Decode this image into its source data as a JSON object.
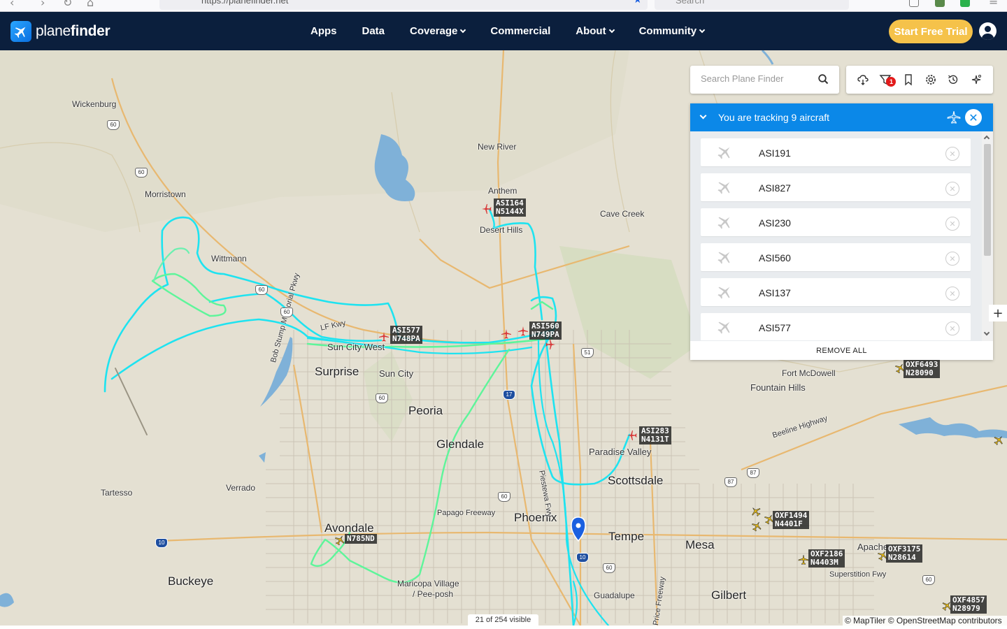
{
  "browser": {
    "url": "https://planefinder.net",
    "search_placeholder": "Search"
  },
  "header": {
    "brand_plain": "plane",
    "brand_bold": "finder",
    "nav": [
      {
        "label": "Apps",
        "dropdown": false
      },
      {
        "label": "Data",
        "dropdown": false
      },
      {
        "label": "Coverage",
        "dropdown": true
      },
      {
        "label": "Commercial",
        "dropdown": false
      },
      {
        "label": "About",
        "dropdown": true
      },
      {
        "label": "Community",
        "dropdown": true
      }
    ],
    "cta_label": "Start Free Trial",
    "colors": {
      "bar": "#0b1f3d",
      "cta": "#f5c24a"
    }
  },
  "map_search": {
    "placeholder": "Search Plane Finder"
  },
  "toolbar": {
    "icons": [
      "weather-icon",
      "filter-icon",
      "bookmark-icon",
      "settings-icon",
      "history-icon",
      "radar-icon"
    ],
    "filter_badge": "1"
  },
  "tracking": {
    "title": "You are tracking 9 aircraft",
    "items": [
      "ASI191",
      "ASI827",
      "ASI230",
      "ASI560",
      "ASI137",
      "ASI577"
    ],
    "remove_all": "REMOVE ALL",
    "color": "#0b88e8"
  },
  "map": {
    "places": {
      "wickenburg": "Wickenburg",
      "morristown": "Morristown",
      "wittmann": "Wittmann",
      "new_river": "New River",
      "anthem": "Anthem",
      "desert_hills": "Desert Hills",
      "cave_creek": "Cave Creek",
      "sun_city_west": "Sun City West",
      "surprise": "Surprise",
      "sun_city": "Sun City",
      "peoria": "Peoria",
      "glendale": "Glendale",
      "tartesso": "Tartesso",
      "verrado": "Verrado",
      "avondale": "Avondale",
      "buckeye": "Buckeye",
      "phoenix": "Phoenix",
      "tempe": "Tempe",
      "mesa": "Mesa",
      "gilbert": "Gilbert",
      "scottsdale": "Scottsdale",
      "paradise_valley": "Paradise Valley",
      "fountain_hills": "Fountain Hills",
      "fort_mcdowell": "Fort McDowell",
      "apache": "Apache",
      "guadalupe": "Guadalupe",
      "maricopa_village_1": "Maricopa Village",
      "maricopa_village_2": "/ Pee-posh",
      "papago": "Papago Freeway",
      "superstition": "Superstition Fwy",
      "beeline": "Beeline Highway",
      "bob_stump": "Bob Stump Memorial Pkwy",
      "lf_kwy": "LF Kwy",
      "piestewa": "Piestewa Fwy",
      "price": "Price Freeway"
    },
    "shields": {
      "s60a": "60",
      "s60b": "60",
      "s60c": "60",
      "s60d": "60",
      "s60e": "60",
      "s60f": "60",
      "s60g": "60",
      "s60h": "60",
      "s51": "51",
      "s87a": "87",
      "s87b": "87",
      "i17": "17",
      "i10a": "10",
      "i10b": "10"
    },
    "aircraft": [
      {
        "line1": "ASI164",
        "line2": "N5144X"
      },
      {
        "line1": "ASI577",
        "line2": "N748PA"
      },
      {
        "line1": "ASI560",
        "line2": "N749PA"
      },
      {
        "line1": "ASI283",
        "line2": "N4131T"
      },
      {
        "line1": "OXF6493",
        "line2": "N28090"
      },
      {
        "line1": "OXF1494",
        "line2": "N4401F"
      },
      {
        "line1": "OXF2186",
        "line2": "N4403M"
      },
      {
        "line1": "OXF3175",
        "line2": "N28614"
      },
      {
        "line1": "OXF4857",
        "line2": "N28979"
      },
      {
        "line1": "",
        "line2": "N785ND"
      }
    ],
    "track_colors": {
      "cyan": "#1ee3f0",
      "green": "#5ef59a"
    }
  },
  "footer": {
    "visible_count": "21 of 254 visible",
    "attribution": "© MapTiler © OpenStreetMap contributors"
  },
  "zoom_plus": "+"
}
